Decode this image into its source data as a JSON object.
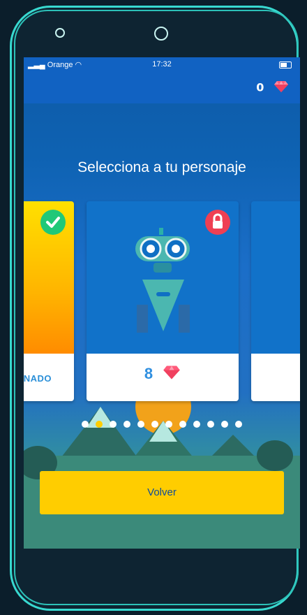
{
  "status_bar": {
    "carrier": "Orange",
    "time": "17:32"
  },
  "header": {
    "gem_count": "0"
  },
  "screen": {
    "title": "Selecciona a tu personaje"
  },
  "cards": [
    {
      "state": "selected",
      "label": "NADO"
    },
    {
      "state": "locked",
      "price": "8"
    },
    {
      "state": "partial"
    }
  ],
  "pagination": {
    "total": 12,
    "active_index": 1
  },
  "actions": {
    "back_label": "Volver"
  },
  "colors": {
    "accent": "#ffcd00",
    "brand_blue": "#1162c2",
    "gem": "#ff5a7a",
    "check": "#20c878",
    "lock": "#ef3f53"
  }
}
